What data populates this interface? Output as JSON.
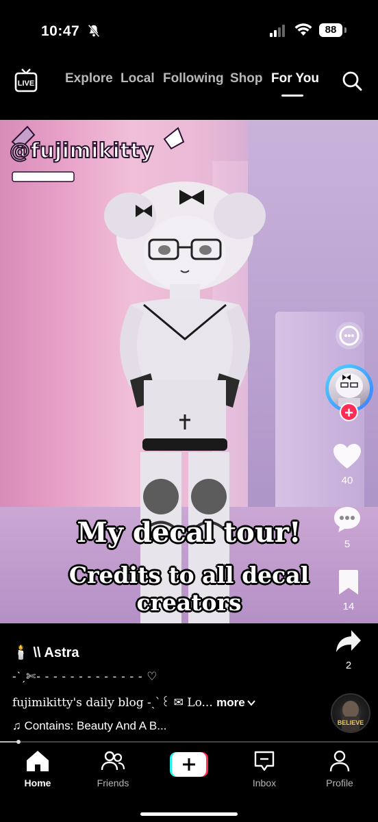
{
  "status_bar": {
    "time": "10:47",
    "battery": "88"
  },
  "top_nav": {
    "live_label": "LIVE",
    "tabs": [
      "Explore",
      "Local",
      "Following",
      "Shop",
      "For You"
    ],
    "active_tab": "For You"
  },
  "video": {
    "watermark": "@fujimikitty",
    "caption_line1": "My decal tour!",
    "caption_line2": "Credits to all decal creators"
  },
  "side_rail": {
    "likes": "40",
    "comments": "5",
    "saves": "14",
    "shares": "2",
    "follow_symbol": "+"
  },
  "post": {
    "author": "🕯️ \\\\ Astra",
    "line2": "-ˋˏ✄- - - - - - - - - - - - - ♡",
    "description": "fujimikitty's daily blog -ˏˋ꒰ ✉ Lo...",
    "more_label": "more",
    "music": "♫ Contains: Beauty And A B...",
    "disc_label": "BELIEVE"
  },
  "bottom_nav": {
    "items": [
      "Home",
      "Friends",
      "Inbox",
      "Profile"
    ],
    "active": "Home"
  },
  "colors": {
    "accent_red": "#ff2c55",
    "accent_cyan": "#25f4ee",
    "background": "#000000"
  }
}
